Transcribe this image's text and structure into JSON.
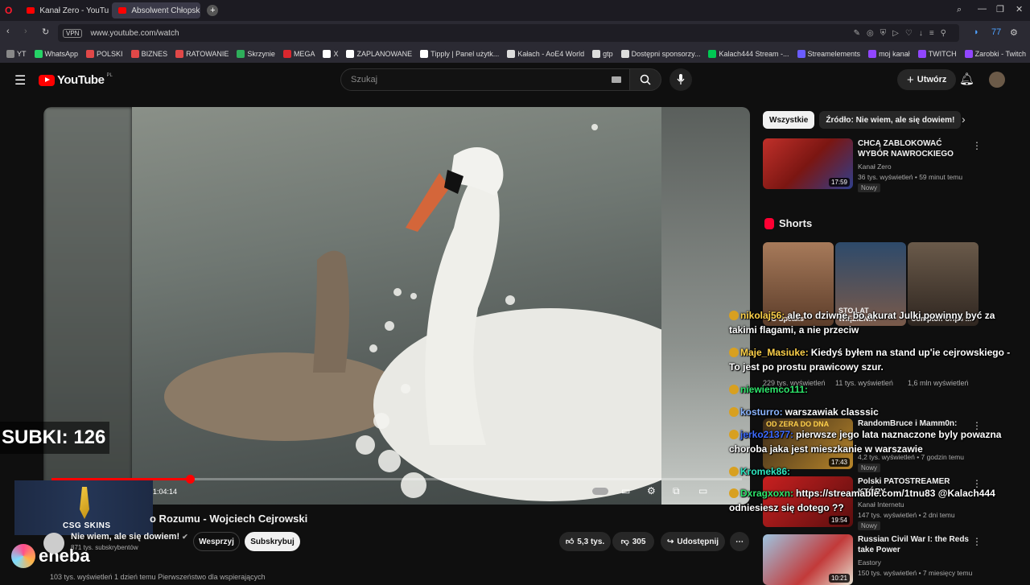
{
  "browser": {
    "tabs": [
      {
        "label": "Kanał Zero - YouTube",
        "active": false
      },
      {
        "label": "Absolwent Chłopskiego R",
        "active": true
      }
    ],
    "vpn_label": "VPN",
    "url": "www.youtube.com/watch",
    "bookmarks": [
      {
        "label": "YT",
        "color": "#888888"
      },
      {
        "label": "WhatsApp",
        "color": "#25d366"
      },
      {
        "label": "POLSKI",
        "color": "#e04848"
      },
      {
        "label": "BIZNES",
        "color": "#e04848"
      },
      {
        "label": "RATOWANIE",
        "color": "#e04848"
      },
      {
        "label": "Skrzynie",
        "color": "#2eae5a"
      },
      {
        "label": "MEGA",
        "color": "#d9272e"
      },
      {
        "label": "X",
        "color": "#ffffff"
      },
      {
        "label": "ZAPLANOWANE",
        "color": "#ffffff"
      },
      {
        "label": "Tipply | Panel użytk...",
        "color": "#ffffff"
      },
      {
        "label": "Kałach - AoE4 World",
        "color": "#dddddd"
      },
      {
        "label": "gtp",
        "color": "#dddddd"
      },
      {
        "label": "Dostępni sponsorzy...",
        "color": "#dddddd"
      },
      {
        "label": "Kalach444 Stream -...",
        "color": "#00c853"
      },
      {
        "label": "Streamelements",
        "color": "#6a5cff"
      },
      {
        "label": "moj kanał",
        "color": "#9146ff"
      },
      {
        "label": "TWITCH",
        "color": "#9146ff"
      },
      {
        "label": "Zarobki - Twitch",
        "color": "#9146ff"
      },
      {
        "label": "DOM",
        "color": "#dddddd"
      }
    ]
  },
  "youtube": {
    "logo_text": "YouTube",
    "country": "PL",
    "search_placeholder": "Szukaj",
    "create_label": "Utwórz"
  },
  "video": {
    "progress_fraction": 0.2,
    "timecode": "1:04:14",
    "title_visible": "o Rozumu - Wojciech Cejrowski",
    "channel_name": "Nie wiem, ale się dowiem!",
    "channel_subs": "871 tys. subskrybentów",
    "support_label": "Wesprzyj",
    "subscribe_label": "Subskrybuj",
    "likes": "5,3 tys.",
    "dislikes": "305",
    "share_label": "Udostępnij",
    "views_line": "103 tys. wyświetleń  1 dzień temu  Pierwszeństwo dla wspierających"
  },
  "overlay": {
    "subki": "SUBKI: 126",
    "csg_label": "CSG SKINS",
    "eneba_label": "eneba"
  },
  "sidebar": {
    "chips": [
      {
        "label": "Wszystkie",
        "active": true
      },
      {
        "label": "Źródło: Nie wiem, ale się dowiem!",
        "active": false
      }
    ],
    "recs": [
      {
        "title": "CHCĄ ZABLOKOWAĆ WYBÓR NAWROCKIEGO",
        "channel": "Kanał Zero",
        "meta": "36 tys. wyświetleń • 59 minut temu",
        "badge": "Nowy",
        "duration": "17:59"
      },
      {
        "title": "RandomBruce i Mamm0n:",
        "channel": "",
        "meta": "4,2 tys. wyświetleń • 7 godzin temu",
        "badge": "Nowy",
        "duration": "17:43"
      },
      {
        "title": "Polski PATOSTREAMER KTÓRY",
        "channel": "Kanał Internetu",
        "meta": "147 tys. wyświetleń • 2 dni temu",
        "badge": "Nowy",
        "duration": "19:54"
      },
      {
        "title": "Russian Civil War I: the Reds take Power",
        "channel": "Eastory",
        "meta": "150 tys. wyświetleń • 7 miesięcy temu",
        "badge": "",
        "duration": "10:21"
      }
    ],
    "shorts_label": "Shorts",
    "shorts": [
      {
        "title": "YG Speaks",
        "views": "229 tys. wyświetleń"
      },
      {
        "title": "STO LAT WIĘZIENIA",
        "views": "11 tys. wyświetleń"
      },
      {
        "title": "Compton Crips ...",
        "views": "1,6 mln wyświetleń"
      }
    ]
  },
  "chat": [
    {
      "user": "nikolaj56:",
      "color": "#ffd24a",
      "msg": "ale to dziwne, bo akurat Julki powinny być za takimi flagami, a nie przeciw"
    },
    {
      "user": "Maje_Masiuke:",
      "color": "#ffd24a",
      "msg": "Kiedyś byłem na stand up'ie cejrowskiego - To jest po prostu prawicowy szur."
    },
    {
      "user": "niewiemco111:",
      "color": "#2ee66b",
      "msg": ""
    },
    {
      "user": "kosturro:",
      "color": "#8ab4ff",
      "msg": "warszawiak classsic"
    },
    {
      "user": "jerko21377:",
      "color": "#3d6bff",
      "msg": "pierwsze jego lata naznaczone byly powazna choroba jaka jest mieszkanie w warszawie"
    },
    {
      "user": "Kromek86:",
      "color": "#2ee6c0",
      "msg": ""
    },
    {
      "user": "Dxragxoxn:",
      "color": "#2ee66b",
      "msg": "https://streamable.com/1tnu83 @Kalach444 odniesiesz się dotego ?? "
    }
  ]
}
